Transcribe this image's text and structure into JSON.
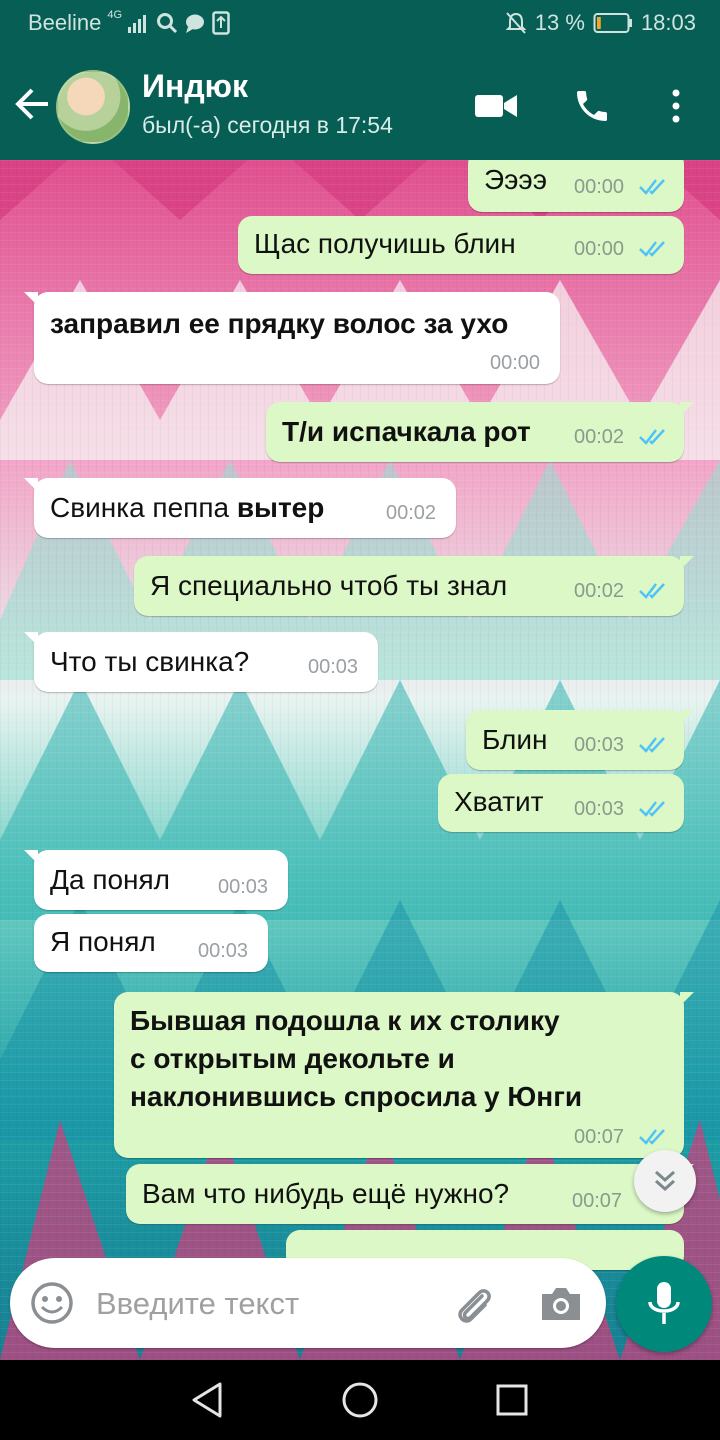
{
  "status_bar": {
    "carrier": "Beeline",
    "network": "4G",
    "battery_percent": "13 %",
    "battery_level": 0.13,
    "time": "18:03"
  },
  "header": {
    "contact_name": "Индюк",
    "last_seen": "был(-а) сегодня в 17:54",
    "icons": [
      "back-arrow-icon",
      "video-call-icon",
      "phone-call-icon",
      "more-vert-icon"
    ]
  },
  "messages": [
    {
      "dir": "out",
      "text": "Ээээ",
      "time": "00:00",
      "read": true
    },
    {
      "dir": "out",
      "text": "Щас получишь блин",
      "time": "00:00",
      "read": true
    },
    {
      "dir": "in",
      "text": "заправил ее прядку волос за ухо",
      "time": "00:00",
      "bold": true
    },
    {
      "dir": "out",
      "text": "Т/и испачкала рот",
      "time": "00:02",
      "read": true,
      "bold": true
    },
    {
      "dir": "in",
      "text_plain": "Свинка пеппа ",
      "text_bold": "вытер",
      "time": "00:02"
    },
    {
      "dir": "out",
      "text": "Я специально чтоб ты знал",
      "time": "00:02",
      "read": true
    },
    {
      "dir": "in",
      "text": "Что ты свинка?",
      "time": "00:03"
    },
    {
      "dir": "out",
      "text": "Блин",
      "time": "00:03",
      "read": true
    },
    {
      "dir": "out",
      "text": "Хватит",
      "time": "00:03",
      "read": true
    },
    {
      "dir": "in",
      "text": "Да понял",
      "time": "00:03"
    },
    {
      "dir": "in",
      "text": "Я понял",
      "time": "00:03"
    },
    {
      "dir": "out",
      "lines": [
        "Бывшая подошла к их столику",
        "с открытым декольте и",
        "наклонившись спросила у Юнги"
      ],
      "time": "00:07",
      "read": true,
      "bold": true
    },
    {
      "dir": "out",
      "text": "Вам что нибудь ещё нужно?",
      "time": "00:07",
      "read": true
    }
  ],
  "input": {
    "placeholder": "Введите текст",
    "icons": [
      "emoji-icon",
      "attach-icon",
      "camera-icon",
      "mic-icon"
    ]
  },
  "colors": {
    "header": "#075e54",
    "outgoing_bubble": "#dcf8c6",
    "incoming_bubble": "#ffffff",
    "read_tick": "#4fc3f7",
    "mic_button": "#00897b"
  }
}
